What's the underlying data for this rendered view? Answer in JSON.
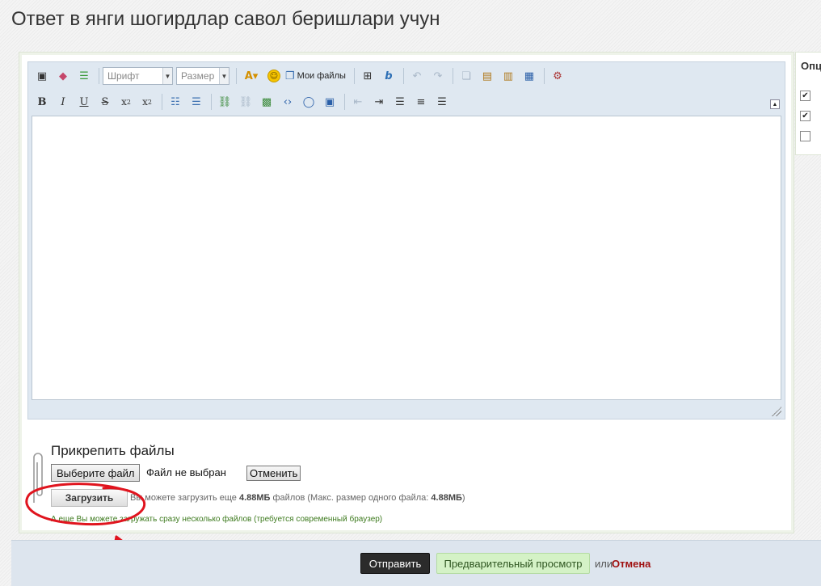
{
  "page": {
    "title": "Ответ в янги шогирдлар савол беришлари учун"
  },
  "editor": {
    "font_placeholder": "Шрифт",
    "size_placeholder": "Размер",
    "my_files_label": "Мои файлы",
    "toolbar_row1_icons": [
      "source-icon",
      "eraser-icon",
      "template-icon",
      "font-color-icon",
      "smiley-icon",
      "my-files-icon",
      "table-icon",
      "bbcode-icon",
      "undo-icon",
      "redo-icon",
      "copy-icon",
      "paste-icon",
      "paste-text-icon",
      "paste-word-icon",
      "settings-icon"
    ],
    "toolbar_row2_icons": [
      "bold-icon",
      "italic-icon",
      "underline-icon",
      "strikethrough-icon",
      "subscript-icon",
      "superscript-icon",
      "bullet-list-icon",
      "numbered-list-icon",
      "link-icon",
      "unlink-icon",
      "image-icon",
      "code-icon",
      "quote-icon",
      "video-icon",
      "outdent-icon",
      "indent-icon",
      "align-left-icon",
      "align-center-icon",
      "align-right-icon"
    ]
  },
  "options": {
    "title": "Опц",
    "checkboxes": [
      true,
      true,
      false
    ]
  },
  "attachments": {
    "title": "Прикрепить файлы",
    "choose_file_label": "Выберите файл",
    "no_file_text": "Файл не выбран",
    "cancel_label": "Отменить",
    "upload_label": "Загрузить",
    "info_prefix": "Вы можете загрузить еще ",
    "info_remaining": "4.88МБ",
    "info_middle": " файлов (Макс. размер одного файла: ",
    "info_max": "4.88МБ",
    "info_suffix": ")",
    "multi_note": "А еще Вы можете загружать сразу несколько файлов (требуется современный браузер)"
  },
  "footer": {
    "submit_label": "Отправить",
    "preview_label": "Предварительный просмотр",
    "or_text": "или",
    "cancel_link": "Отмена"
  },
  "annotation": {
    "color": "#e0141e"
  }
}
